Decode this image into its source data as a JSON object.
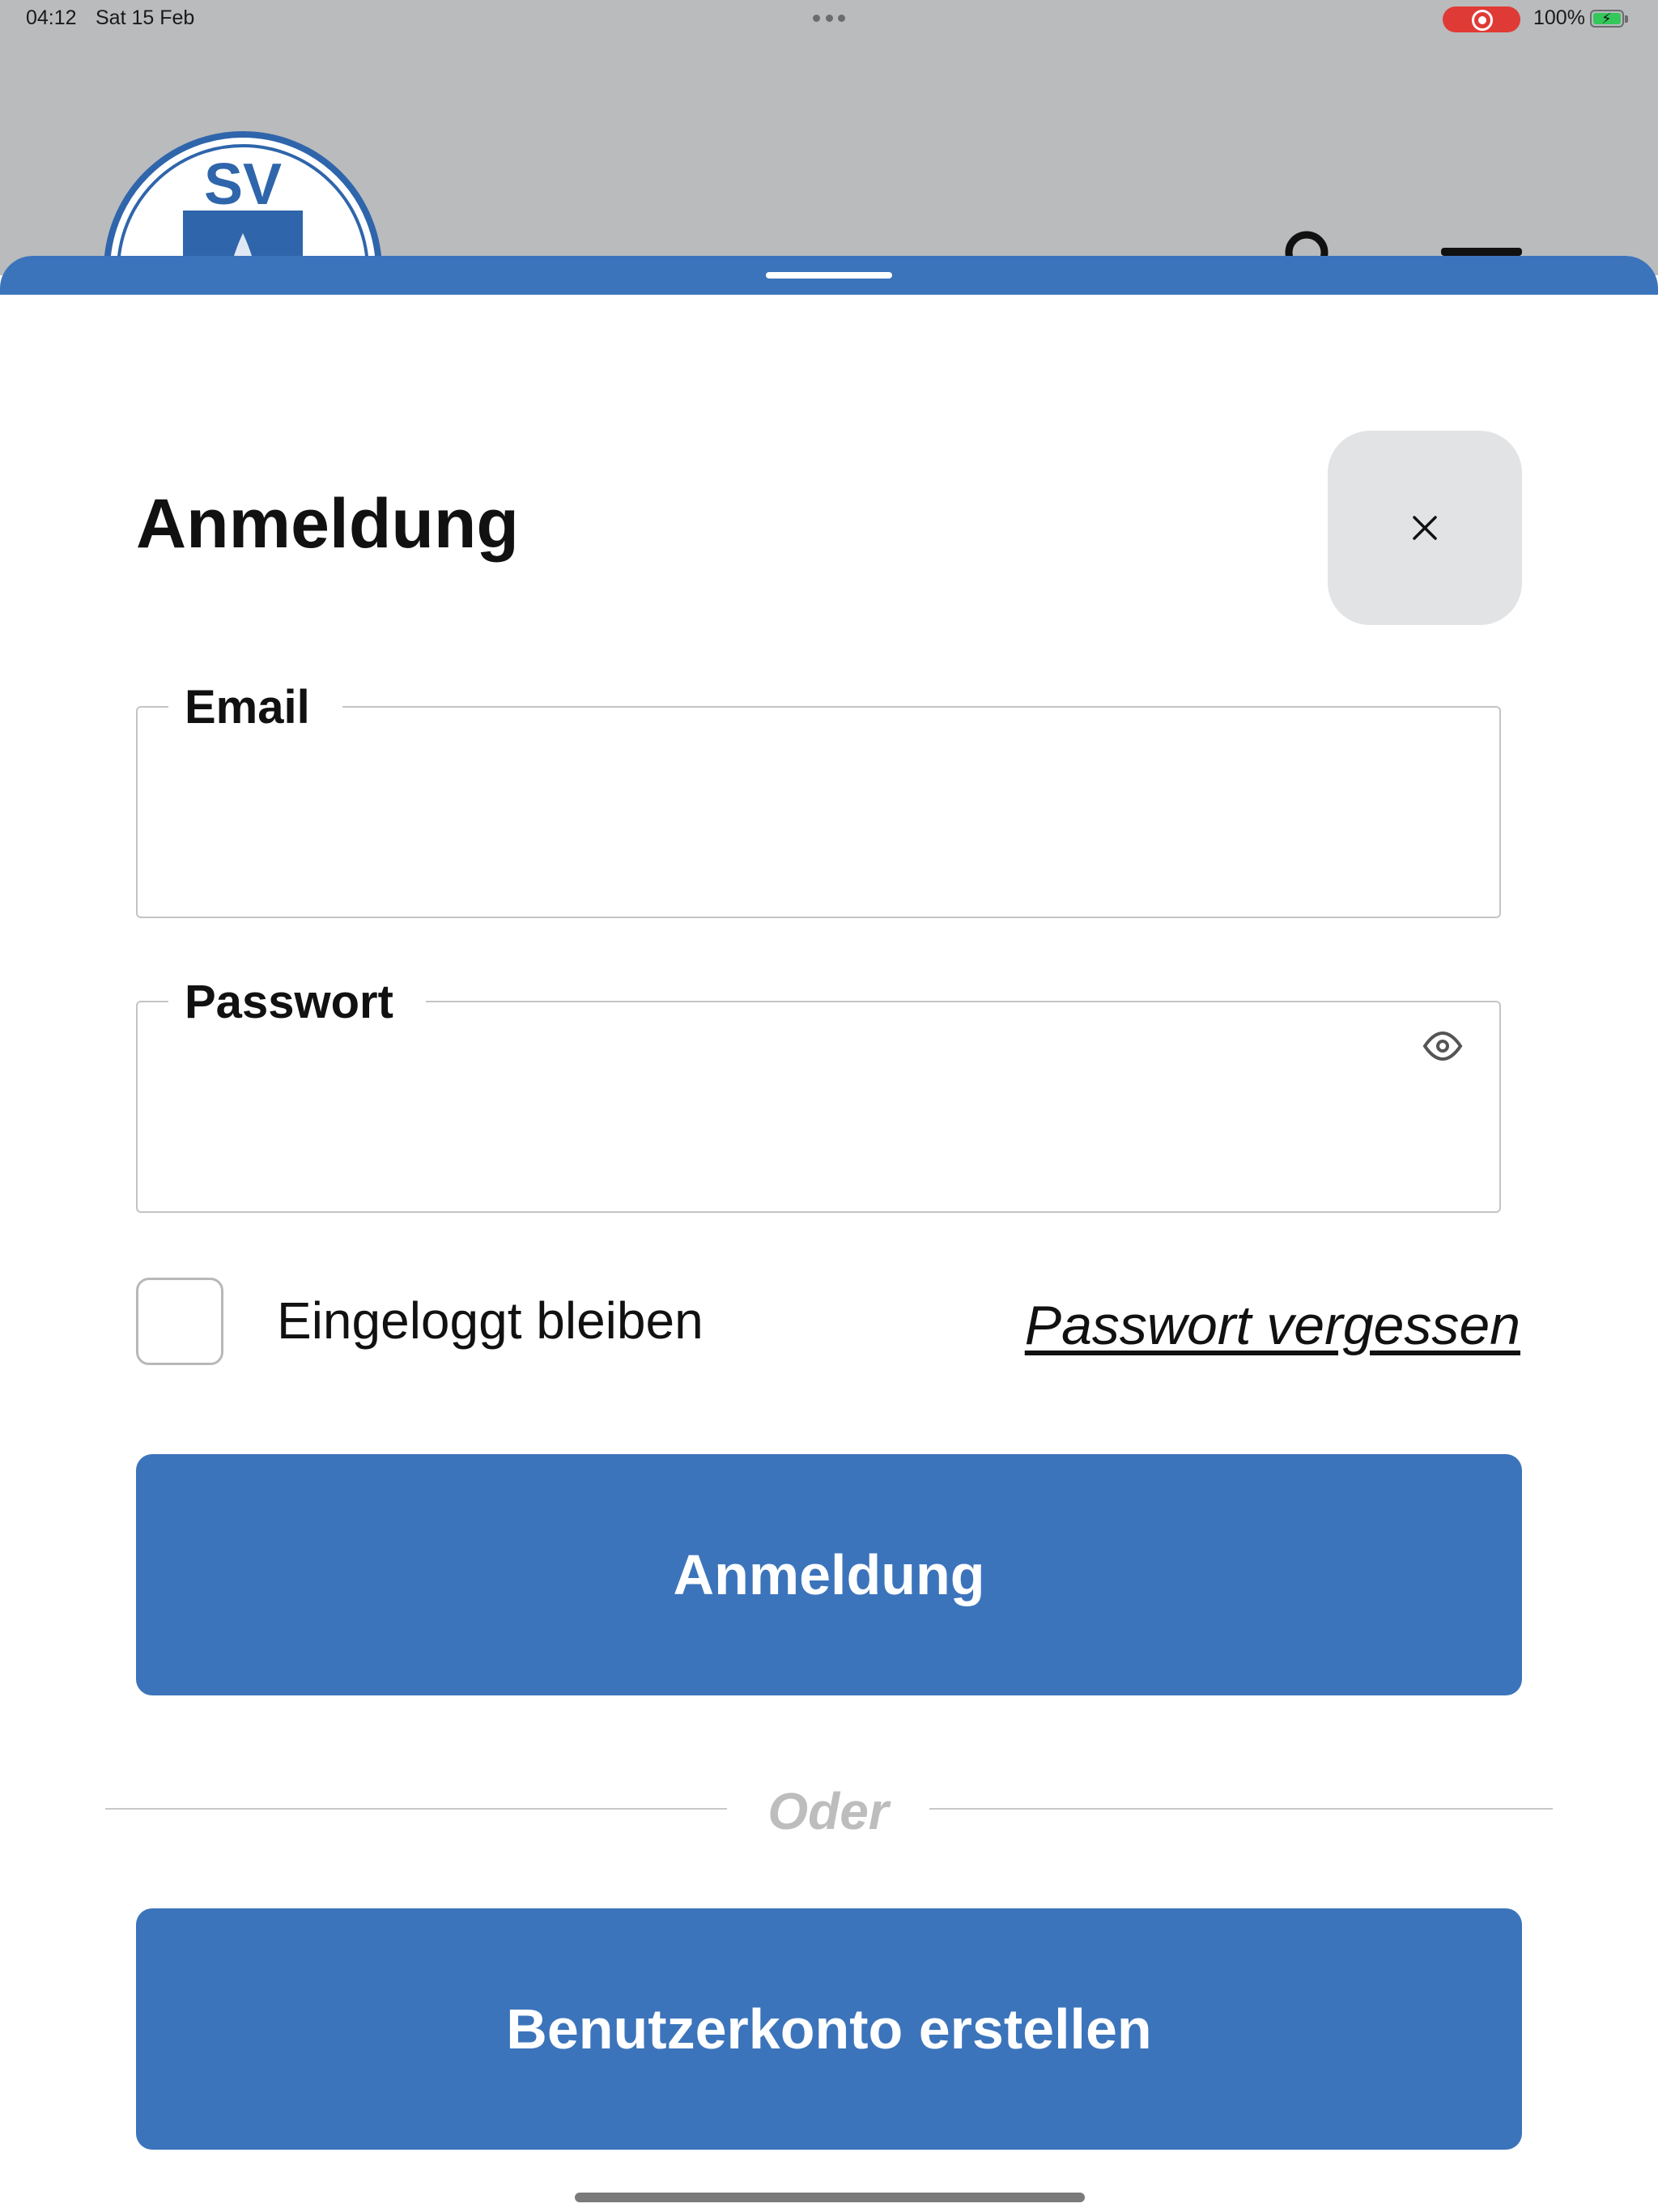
{
  "status_bar": {
    "time": "04:12",
    "date": "Sat 15 Feb",
    "battery_percent": "100%",
    "battery_level": 1.0,
    "recording": true
  },
  "background": {
    "logo_text": "SV",
    "icons": [
      "search-icon",
      "menu-icon"
    ]
  },
  "dialog": {
    "title": "Anmeldung",
    "close_icon": "close-icon",
    "email": {
      "label": "Email",
      "value": "",
      "placeholder": ""
    },
    "password": {
      "label": "Passwort",
      "value": "",
      "placeholder": "",
      "toggle_icon": "eye-icon"
    },
    "remember_me": {
      "label": "Eingeloggt bleiben",
      "checked": false
    },
    "forgot_password": "Passwort vergessen",
    "login_button": "Anmeldung",
    "divider_text": "Oder",
    "register_button": "Benutzerkonto erstellen"
  },
  "colors": {
    "primary": "#3c74bb",
    "backdrop": "#b9bbbd",
    "close_button_bg": "#e2e3e5",
    "recording": "#e03a36",
    "battery": "#34c759",
    "divider_text": "#bdbdbd"
  }
}
